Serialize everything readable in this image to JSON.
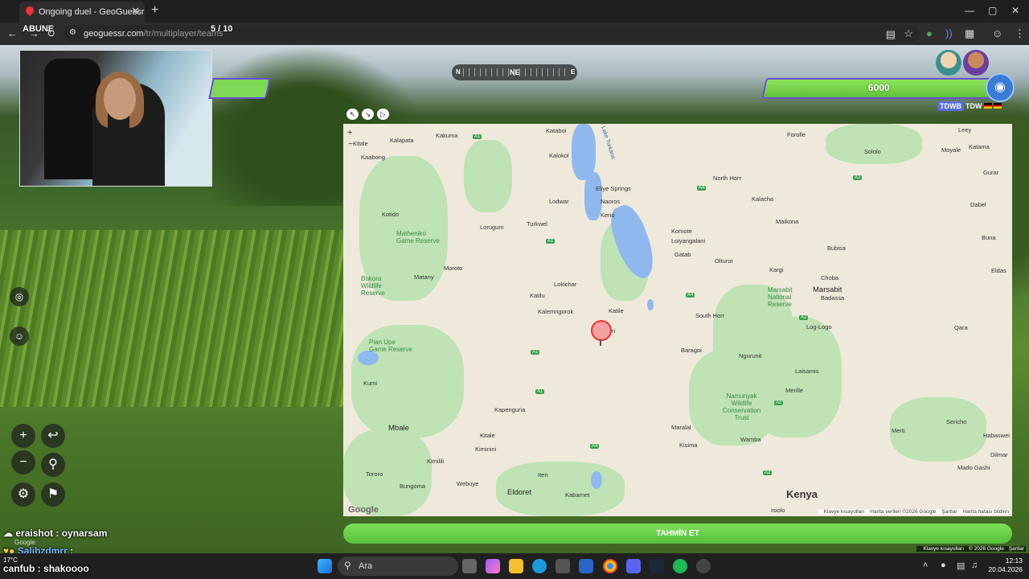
{
  "browser": {
    "tab_title": "Ongoing duel - GeoGuessr",
    "tab_close": "✕",
    "new_tab": "+",
    "url_host": "geoguessr.com",
    "url_path": "/tr/multiplayer/teams",
    "win_min": "—",
    "win_max": "▢",
    "win_close": "✕"
  },
  "overlay": {
    "abune": "ABUNE",
    "round": "5 / 10"
  },
  "game": {
    "opponent_score": "6000",
    "team_tag_1": "TDWB",
    "team_tag_2": "TDW",
    "compass": {
      "n": "N",
      "ne": "NE",
      "e": "E"
    },
    "guess_button": "TAHMİN ET"
  },
  "map": {
    "places": [
      {
        "id": "kataboi",
        "text": "Kataboi"
      },
      {
        "id": "kakuma",
        "text": "Kakuma"
      },
      {
        "id": "kalapata",
        "text": "Kalapata"
      },
      {
        "id": "kitale_top",
        "text": "Kitale"
      },
      {
        "id": "kaabong",
        "text": "Kaabong"
      },
      {
        "id": "kalokol",
        "text": "Kalokol"
      },
      {
        "id": "lodwar",
        "text": "Lodwar"
      },
      {
        "id": "eliye",
        "text": "Eliye Springs"
      },
      {
        "id": "naoros",
        "text": "Naoros"
      },
      {
        "id": "keno",
        "text": "Keno"
      },
      {
        "id": "kotido",
        "text": "Kotido"
      },
      {
        "id": "lorugum",
        "text": "Lorugum"
      },
      {
        "id": "turkwel",
        "text": "Turkwel"
      },
      {
        "id": "moroto",
        "text": "Moroto"
      },
      {
        "id": "matany",
        "text": "Matany"
      },
      {
        "id": "lokichar",
        "text": "Lokichar"
      },
      {
        "id": "katilu",
        "text": "Katilu"
      },
      {
        "id": "kalemngorok",
        "text": "Kalemngorok"
      },
      {
        "id": "katile",
        "text": "Katile"
      },
      {
        "id": "lori",
        "text": "ori"
      },
      {
        "id": "komote",
        "text": "Komote"
      },
      {
        "id": "loiyangalani",
        "text": "Loiyangalani"
      },
      {
        "id": "gatab",
        "text": "Gatab"
      },
      {
        "id": "olturot",
        "text": "Olturot"
      },
      {
        "id": "northhorr",
        "text": "North Horr"
      },
      {
        "id": "kalacha",
        "text": "Kalacha"
      },
      {
        "id": "maikona",
        "text": "Maikona"
      },
      {
        "id": "forolle",
        "text": "Forolle"
      },
      {
        "id": "leey",
        "text": "Leey"
      },
      {
        "id": "sololo",
        "text": "Sololo"
      },
      {
        "id": "moyale",
        "text": "Moyale"
      },
      {
        "id": "katama",
        "text": "Katama"
      },
      {
        "id": "gurar",
        "text": "Gurar"
      },
      {
        "id": "dabel",
        "text": "Dabel"
      },
      {
        "id": "buna",
        "text": "Buna"
      },
      {
        "id": "bubisa",
        "text": "Bubisa"
      },
      {
        "id": "kargi",
        "text": "Kargi"
      },
      {
        "id": "choba",
        "text": "Choba"
      },
      {
        "id": "marsabit",
        "text": "Marsabit"
      },
      {
        "id": "badassa",
        "text": "Badassa"
      },
      {
        "id": "eldas",
        "text": "Eldas"
      },
      {
        "id": "southhorr",
        "text": "South Horr"
      },
      {
        "id": "logologo",
        "text": "Log-Logo"
      },
      {
        "id": "qara",
        "text": "Qara"
      },
      {
        "id": "baragoi",
        "text": "Baragoi"
      },
      {
        "id": "ngurunit",
        "text": "Ngurunit"
      },
      {
        "id": "laisamis",
        "text": "Laisamis"
      },
      {
        "id": "kumi",
        "text": "Kumi"
      },
      {
        "id": "merille",
        "text": "Merille"
      },
      {
        "id": "kapenguria",
        "text": "Kapenguria"
      },
      {
        "id": "mbale",
        "text": "Mbale"
      },
      {
        "id": "kitale",
        "text": "Kitale"
      },
      {
        "id": "kiminini",
        "text": "Kiminini"
      },
      {
        "id": "kimilili",
        "text": "Kimilili"
      },
      {
        "id": "maralal",
        "text": "Maralal"
      },
      {
        "id": "kisima",
        "text": "Kisima"
      },
      {
        "id": "wamba",
        "text": "Wamba"
      },
      {
        "id": "sericho",
        "text": "Sericho"
      },
      {
        "id": "merti",
        "text": "Merti"
      },
      {
        "id": "habaswein",
        "text": "Habaswei"
      },
      {
        "id": "dilmar",
        "text": "Dilmar"
      },
      {
        "id": "madogashi",
        "text": "Mado Gashi"
      },
      {
        "id": "tororo",
        "text": "Tororo"
      },
      {
        "id": "bungoma",
        "text": "Bungoma"
      },
      {
        "id": "webuye",
        "text": "Webuye"
      },
      {
        "id": "iten",
        "text": "Iten"
      },
      {
        "id": "eldoret",
        "text": "Eldoret"
      },
      {
        "id": "kabarnet",
        "text": "Kabarnet"
      },
      {
        "id": "isiolo",
        "text": "Isiolo"
      }
    ],
    "parks": [
      {
        "id": "matheniko",
        "text": "Matheniko\nGame Reserve"
      },
      {
        "id": "bokora",
        "text": "Bokora\nWildlife\nReserve"
      },
      {
        "id": "pianupe",
        "text": "Pian Upe\nGame Reserve"
      },
      {
        "id": "marsabitnr",
        "text": "Marsabit\nNational\nReserve"
      },
      {
        "id": "namunyak",
        "text": "Namunyak\nWildlife\nConservation\nTrust"
      }
    ],
    "water": {
      "turkana": "Lake Turkana"
    },
    "country": "Kenya",
    "roads": [
      "A1",
      "A1",
      "A1",
      "A1",
      "A4",
      "A4",
      "A4",
      "A2",
      "A2",
      "A2",
      "A2"
    ],
    "zoom_in": "+",
    "zoom_out": "−",
    "google": "Google",
    "attribution": {
      "shortcuts": "Klavye kısayolları",
      "data": "Harita verileri ©2026 Google",
      "terms": "Şartlar",
      "report": "Harita hatası bildirin"
    }
  },
  "footer_attr": {
    "shortcuts": "Klavye kısayolları",
    "copy": "© 2026 Google",
    "terms": "Şartlar"
  },
  "chat": [
    {
      "user": "eraishot",
      "text": "oynarsam"
    },
    {
      "user": "Salihzdmrr",
      "text": ""
    },
    {
      "user": "canfub",
      "text": "shakoooo"
    }
  ],
  "streetview_google": "Google",
  "weather": {
    "temp": "17°C"
  },
  "taskbar": {
    "search_placeholder": "Ara",
    "time": "12:13",
    "date": "20.04.2026"
  }
}
